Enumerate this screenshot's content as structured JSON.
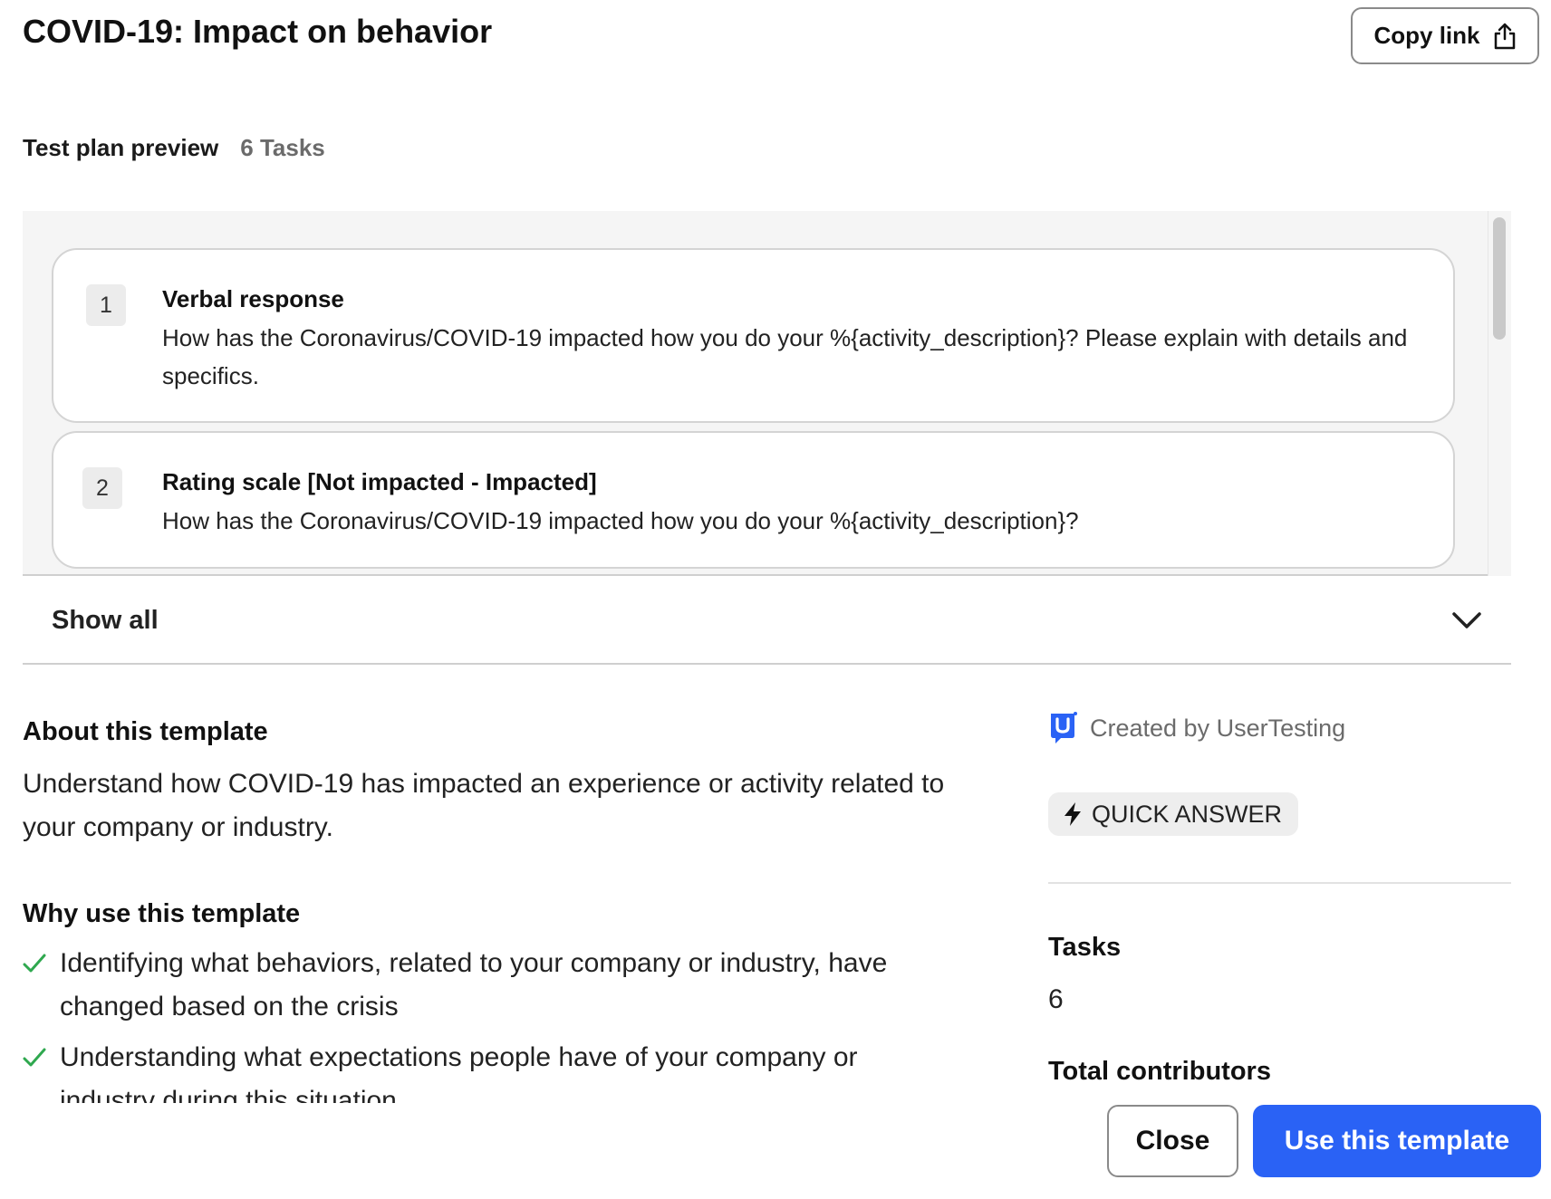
{
  "header": {
    "title": "COVID-19: Impact on behavior",
    "copy_link_label": "Copy link"
  },
  "plan": {
    "label": "Test plan preview",
    "task_count": "6 Tasks",
    "tasks": [
      {
        "number": "1",
        "title": "Verbal response",
        "description": "How has the Coronavirus/COVID-19 impacted how you do your %{activity_description}? Please explain with details and specifics."
      },
      {
        "number": "2",
        "title": "Rating scale [Not impacted - Impacted]",
        "description": "How has the Coronavirus/COVID-19 impacted how you do your %{activity_description}?"
      }
    ],
    "show_all_label": "Show all"
  },
  "about": {
    "title": "About this template",
    "description": "Understand how COVID-19 has impacted an experience or activity related to your company or industry."
  },
  "why": {
    "title": "Why use this template",
    "items": [
      "Identifying what behaviors, related to your company or industry, have changed based on the crisis",
      "Understanding what expectations people have of your company or industry during this situation"
    ]
  },
  "sidebar": {
    "creator": "Created by UserTesting",
    "badge": "QUICK ANSWER",
    "tasks_label": "Tasks",
    "tasks_value": "6",
    "contributors_label": "Total contributors"
  },
  "footer": {
    "close_label": "Close",
    "use_label": "Use this template"
  },
  "colors": {
    "primary": "#2a62f5",
    "check": "#2fa84f",
    "brand": "#2a62f5"
  },
  "icons": [
    "share-icon",
    "chevron-down-icon",
    "check-icon",
    "usertesting-logo-icon",
    "lightning-bolt-icon"
  ]
}
